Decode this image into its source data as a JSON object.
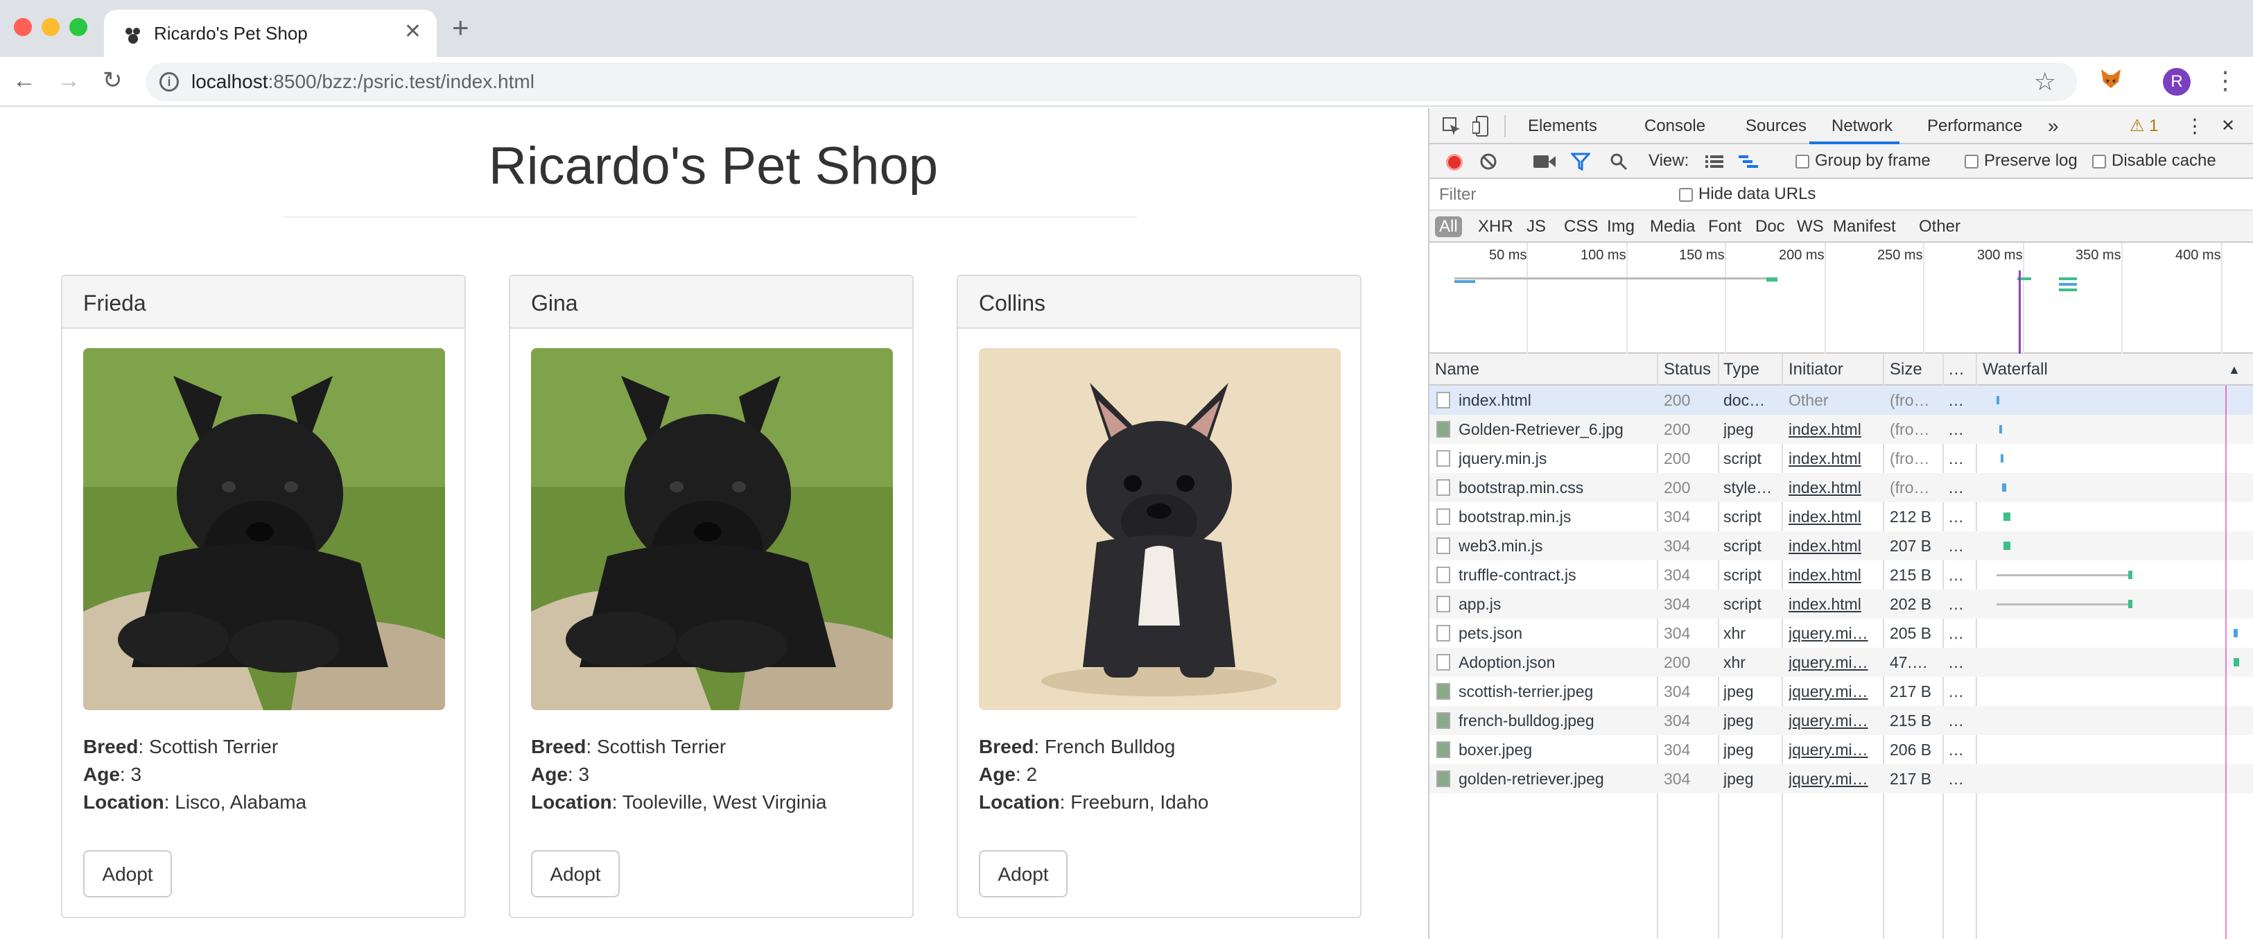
{
  "browser": {
    "tab_title": "Ricardo's Pet Shop",
    "tab_close": "✕",
    "new_tab": "+",
    "url_host": "localhost",
    "url_rest": ":8500/bzz:/psric.test/index.html",
    "avatar_letter": "R",
    "back": "←",
    "forward": "→",
    "reload": "↻",
    "star": "☆",
    "menu": "⋮"
  },
  "page": {
    "title": "Ricardo's Pet Shop",
    "pets": [
      {
        "name": "Frieda",
        "breed": "Scottish Terrier",
        "age": "3",
        "location": "Lisco, Alabama",
        "adopt": "Adopt",
        "image": "scottish-terrier"
      },
      {
        "name": "Gina",
        "breed": "Scottish Terrier",
        "age": "3",
        "location": "Tooleville, West Virginia",
        "adopt": "Adopt",
        "image": "scottish-terrier"
      },
      {
        "name": "Collins",
        "breed": "French Bulldog",
        "age": "2",
        "location": "Freeburn, Idaho",
        "adopt": "Adopt",
        "image": "french-bulldog"
      }
    ],
    "labels": {
      "breed": "Breed",
      "age": "Age",
      "location": "Location"
    }
  },
  "devtools": {
    "tabs": [
      "Elements",
      "Console",
      "Sources",
      "Network",
      "Performance"
    ],
    "active_tab": "Network",
    "more": "»",
    "warnings": "⚠ 1",
    "close": "✕",
    "menu": "⋮",
    "view_label": "View:",
    "group_by_frame": "Group by frame",
    "preserve_log": "Preserve log",
    "disable_cache": "Disable cache",
    "filter_placeholder": "Filter",
    "hide_data_urls": "Hide data URLs",
    "filter_types": [
      "All",
      "XHR",
      "JS",
      "CSS",
      "Img",
      "Media",
      "Font",
      "Doc",
      "WS",
      "Manifest",
      "Other"
    ],
    "overview_ticks": [
      "50 ms",
      "100 ms",
      "150 ms",
      "200 ms",
      "250 ms",
      "300 ms",
      "350 ms",
      "400 ms"
    ],
    "columns": {
      "name": "Name",
      "status": "Status",
      "type": "Type",
      "initiator": "Initiator",
      "size": "Size",
      "more": "…",
      "waterfall": "Waterfall",
      "sort": "▲"
    },
    "requests": [
      {
        "name": "index.html",
        "status": "200",
        "type": "doc…",
        "initiator": "Other",
        "size": "(fro…",
        "more": "…"
      },
      {
        "name": "Golden-Retriever_6.jpg",
        "status": "200",
        "type": "jpeg",
        "initiator": "index.html",
        "size": "(fro…",
        "more": "…"
      },
      {
        "name": "jquery.min.js",
        "status": "200",
        "type": "script",
        "initiator": "index.html",
        "size": "(fro…",
        "more": "…"
      },
      {
        "name": "bootstrap.min.css",
        "status": "200",
        "type": "style…",
        "initiator": "index.html",
        "size": "(fro…",
        "more": "…"
      },
      {
        "name": "bootstrap.min.js",
        "status": "304",
        "type": "script",
        "initiator": "index.html",
        "size": "212 B",
        "more": "…"
      },
      {
        "name": "web3.min.js",
        "status": "304",
        "type": "script",
        "initiator": "index.html",
        "size": "207 B",
        "more": "…"
      },
      {
        "name": "truffle-contract.js",
        "status": "304",
        "type": "script",
        "initiator": "index.html",
        "size": "215 B",
        "more": "…"
      },
      {
        "name": "app.js",
        "status": "304",
        "type": "script",
        "initiator": "index.html",
        "size": "202 B",
        "more": "…"
      },
      {
        "name": "pets.json",
        "status": "304",
        "type": "xhr",
        "initiator": "jquery.mi…",
        "size": "205 B",
        "more": "…"
      },
      {
        "name": "Adoption.json",
        "status": "200",
        "type": "xhr",
        "initiator": "jquery.mi…",
        "size": "47.…",
        "more": "…"
      },
      {
        "name": "scottish-terrier.jpeg",
        "status": "304",
        "type": "jpeg",
        "initiator": "jquery.mi…",
        "size": "217 B",
        "more": "…"
      },
      {
        "name": "french-bulldog.jpeg",
        "status": "304",
        "type": "jpeg",
        "initiator": "jquery.mi…",
        "size": "215 B",
        "more": "…"
      },
      {
        "name": "boxer.jpeg",
        "status": "304",
        "type": "jpeg",
        "initiator": "jquery.mi…",
        "size": "206 B",
        "more": "…"
      },
      {
        "name": "golden-retriever.jpeg",
        "status": "304",
        "type": "jpeg",
        "initiator": "jquery.mi…",
        "size": "217 B",
        "more": "…"
      }
    ]
  },
  "colors": {
    "accent": "#1a73e8",
    "record": "#e0332e",
    "waterfall_wait": "#4fa3e0",
    "waterfall_recv": "#3dbf8a"
  }
}
